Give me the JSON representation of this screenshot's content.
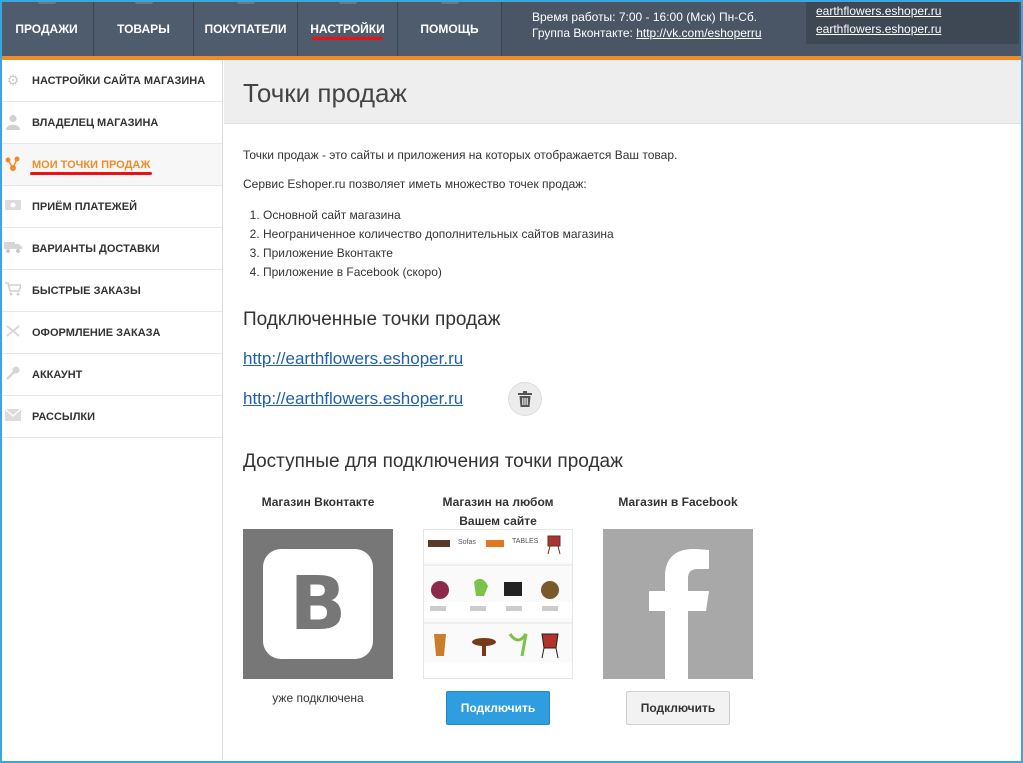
{
  "topnav": {
    "items": [
      {
        "label": "ПРОДАЖИ"
      },
      {
        "label": "ТОВАРЫ"
      },
      {
        "label": "ПОКУПАТЕЛИ"
      },
      {
        "label": "НАСТРОЙКИ",
        "active": true
      },
      {
        "label": "ПОМОЩЬ"
      }
    ],
    "hours": "Время работы: 7:00 - 16:00 (Мск) Пн-Сб.",
    "vk_group_label": "Группа Вконтакте:",
    "vk_group_link": "http://vk.com/eshoperru",
    "sites": [
      "earthflowers.eshoper.ru",
      "earthflowers.eshoper.ru"
    ]
  },
  "sidebar": {
    "items": [
      {
        "label": "НАСТРОЙКИ САЙТА МАГАЗИНА",
        "icon": "gear-icon"
      },
      {
        "label": "ВЛАДЕЛЕЦ МАГАЗИНА",
        "icon": "user-icon"
      },
      {
        "label": "МОИ ТОЧКИ ПРОДАЖ",
        "icon": "sales-points-icon",
        "active": true
      },
      {
        "label": "ПРИЁМ ПЛАТЕЖЕЙ",
        "icon": "money-icon"
      },
      {
        "label": "ВАРИАНТЫ ДОСТАВКИ",
        "icon": "truck-icon"
      },
      {
        "label": "БЫСТРЫЕ ЗАКАЗЫ",
        "icon": "cart-icon"
      },
      {
        "label": "ОФОРМЛЕНИЕ ЗАКАЗА",
        "icon": "checkout-icon"
      },
      {
        "label": "АККАУНТ",
        "icon": "key-icon"
      },
      {
        "label": "РАССЫЛКИ",
        "icon": "mail-icon"
      }
    ]
  },
  "main": {
    "title": "Точки продаж",
    "intro": "Точки продаж - это сайты и приложения на которых отображается Ваш товар.",
    "service": "Сервис Eshoper.ru позволяет иметь множество точек продаж:",
    "list": [
      "Основной сайт магазина",
      "Неограниченное количество дополнительных сайтов магазина",
      "Приложение Вконтакте",
      "Приложение в Facebook (скоро)"
    ],
    "connected_heading": "Подключенные точки продаж",
    "connected_links": [
      "http://earthflowers.eshoper.ru",
      "http://earthflowers.eshoper.ru"
    ],
    "available_heading": "Доступные для подключения точки продаж",
    "cards": [
      {
        "title": "Магазин Вконтакте",
        "status": "уже подключена"
      },
      {
        "title": "Магазин на любом Вашем сайте",
        "button": "Подключить"
      },
      {
        "title": "Магазин в Facebook",
        "button": "Подключить"
      }
    ],
    "site_thumb": {
      "sofas": "Sofas",
      "tables": "TABLES"
    },
    "colors": {
      "accent": "#f08c28",
      "nav_bg": "#4f5c6d",
      "link": "#1e5fae",
      "button_blue": "#2f9ee0"
    }
  }
}
